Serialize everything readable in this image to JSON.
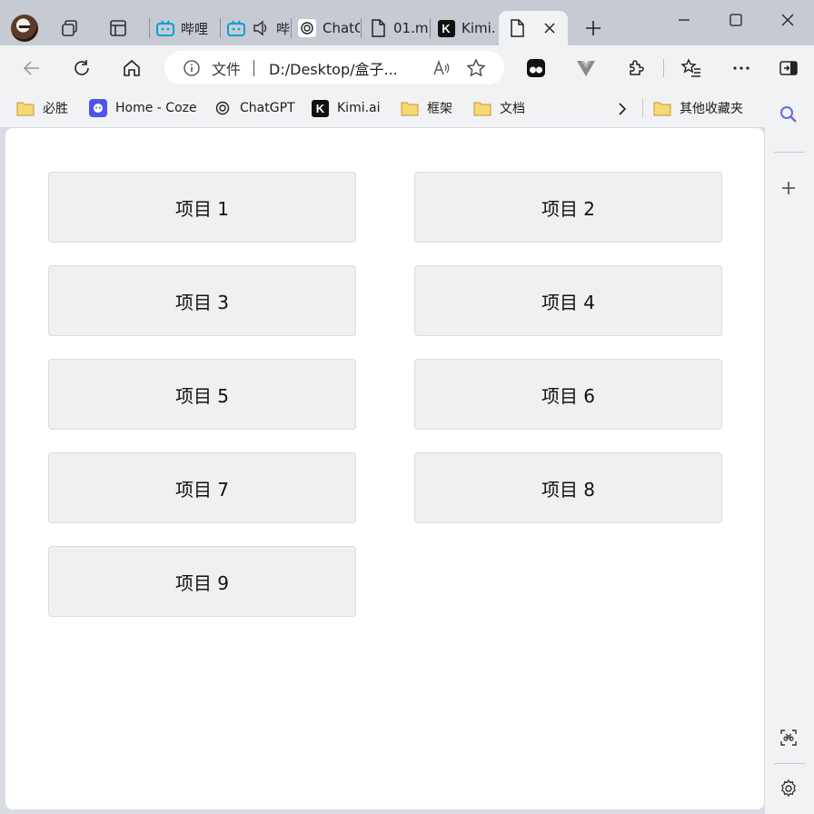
{
  "tabs": [
    {
      "label": "哔哩",
      "icon": "bilibili-icon"
    },
    {
      "label": "",
      "icon": "bilibili-icon",
      "audio": "speaker-icon",
      "extra": "哔"
    },
    {
      "label": "ChatG",
      "icon": "chatgpt-icon"
    },
    {
      "label": "01.m",
      "icon": "file-icon"
    },
    {
      "label": "Kimi.",
      "icon": "kimi-icon"
    },
    {
      "label": "",
      "icon": "file-icon",
      "active": true,
      "close": "close-icon"
    }
  ],
  "address": {
    "site_label": "文件",
    "url": "D:/Desktop/盒子..."
  },
  "bookmarks": [
    {
      "label": "必胜",
      "icon": "folder-icon"
    },
    {
      "label": "Home - Coze",
      "icon": "coze-icon"
    },
    {
      "label": "ChatGPT",
      "icon": "chatgpt-icon"
    },
    {
      "label": "Kimi.ai",
      "icon": "kimi-icon"
    },
    {
      "label": "框架",
      "icon": "folder-icon"
    },
    {
      "label": "文档",
      "icon": "folder-icon"
    },
    {
      "label": "其他收藏夹",
      "icon": "folder-icon"
    }
  ],
  "grid": {
    "items": [
      "项目 1",
      "项目 2",
      "项目 3",
      "项目 4",
      "项目 5",
      "项目 6",
      "项目 7",
      "项目 8",
      "项目 9"
    ]
  },
  "colors": {
    "tabstrip": "#c6cad2",
    "toolbar": "#f1f2f4",
    "item_bg": "#f0f0f0",
    "bilibili": "#00a1d6",
    "folder": "#f5c85c"
  }
}
